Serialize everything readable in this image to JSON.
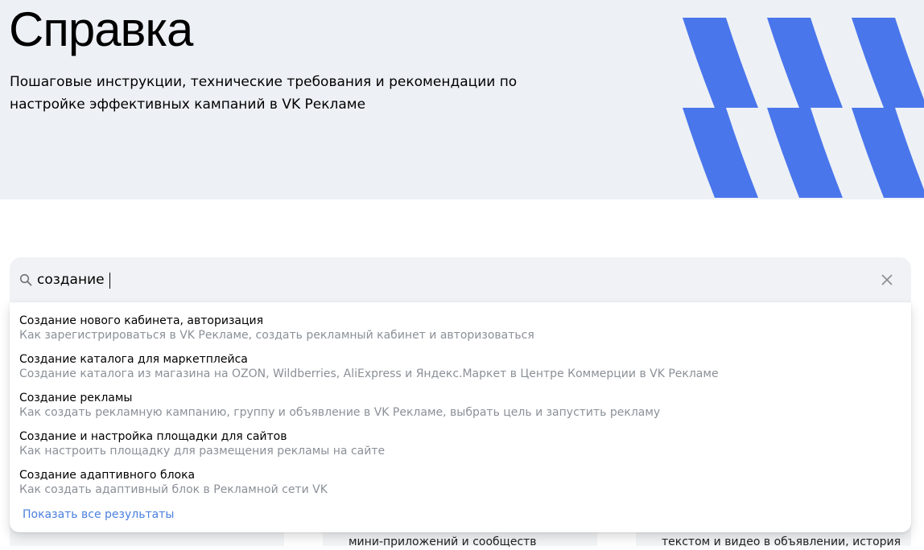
{
  "hero": {
    "title": "Справка",
    "subtitle": "Пошаговые инструкции, технические требования и рекомендации по настройке эффективных кампаний в VK Рекламе"
  },
  "search": {
    "value": "создание",
    "icon": "search-icon",
    "clear_icon": "close-icon"
  },
  "results": [
    {
      "title": "Создание нового кабинета, авторизация",
      "description": "Как зарегистрироваться в VK Рекламе, создать рекламный кабинет и авторизоваться"
    },
    {
      "title": "Создание каталога для маркетплейса",
      "description": "Создание каталога из магазина на OZON, Wildberries, AliExpress и Яндекс.Маркет в Центре Коммерции в VK Рекламе"
    },
    {
      "title": "Создание рекламы",
      "description": "Как создать рекламную кампанию, группу и объявление в VK Рекламе, выбрать цель и запустить рекламу"
    },
    {
      "title": "Создание и настройка площадки для сайтов",
      "description": "Как настроить площадку для размещения рекламы на сайте"
    },
    {
      "title": "Создание адаптивного блока",
      "description": "Как создать адаптивный блок в Рекламной сети VK"
    }
  ],
  "show_all_label": "Показать все результаты",
  "background_cards": [
    {
      "text": ""
    },
    {
      "text": "мини-приложений и сообществ"
    },
    {
      "text": "текстом и видео в объявлении, история"
    }
  ],
  "colors": {
    "hero_background": "#edf1f6",
    "accent_blue": "#4a76ec",
    "link": "#4a7fde",
    "secondary_text": "#8b9097"
  }
}
